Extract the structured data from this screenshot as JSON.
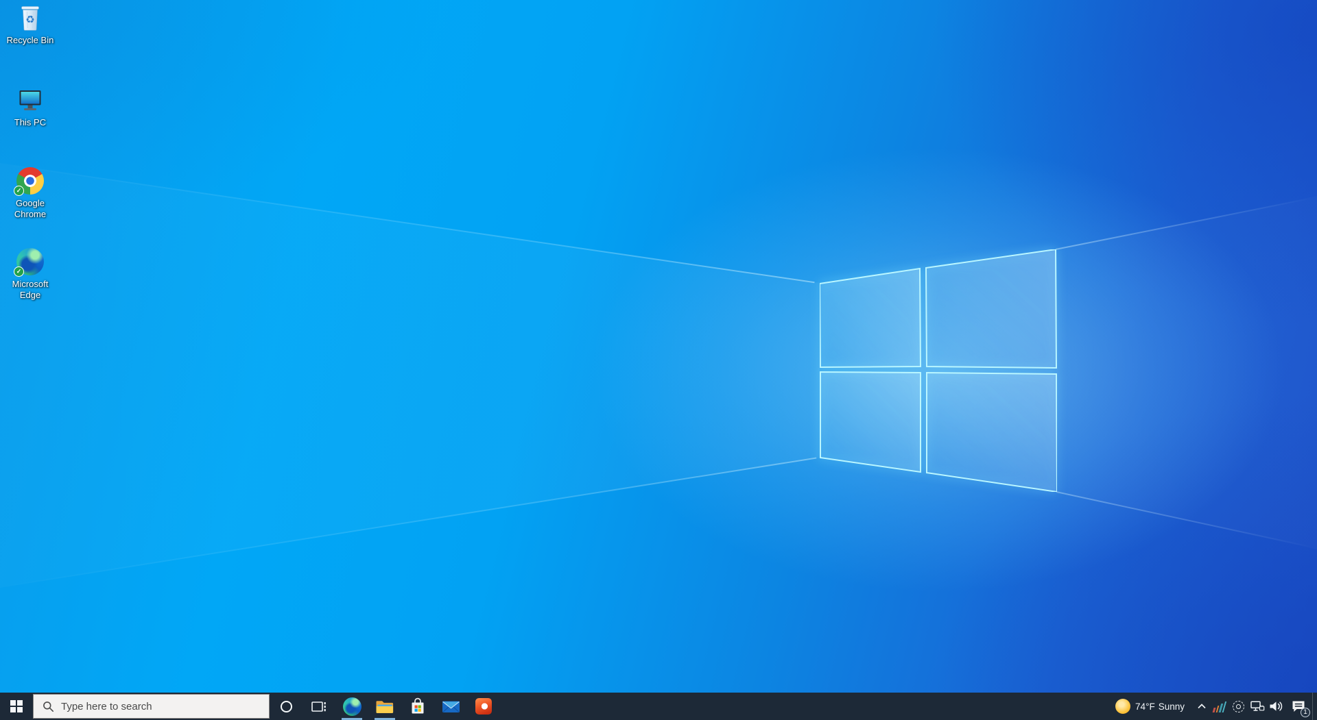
{
  "desktop": {
    "icons": [
      {
        "label": "Recycle Bin",
        "icon": "recycle-bin-icon"
      },
      {
        "label": "This PC",
        "icon": "this-pc-icon"
      },
      {
        "label": "Google Chrome",
        "icon": "chrome-icon",
        "overlay": "check-badge",
        "overlay_glyph": "✓"
      },
      {
        "label": "Microsoft Edge",
        "icon": "edge-icon",
        "overlay": "check-badge",
        "overlay_glyph": "✓"
      }
    ]
  },
  "taskbar": {
    "search": {
      "placeholder": "Type here to search",
      "icon": "search-icon"
    },
    "buttons": [
      {
        "icon": "windows-start-icon"
      },
      {
        "icon": "cortana-icon"
      },
      {
        "icon": "task-view-icon"
      },
      {
        "icon": "edge-icon",
        "open": true
      },
      {
        "icon": "file-explorer-icon",
        "open": true
      },
      {
        "icon": "microsoft-store-icon",
        "open": false
      },
      {
        "icon": "mail-icon",
        "open": false
      },
      {
        "icon": "office-icon",
        "open": false
      }
    ],
    "tray": {
      "weather": {
        "icon": "sun-icon",
        "temperature": "74°F",
        "condition": "Sunny"
      },
      "icons": [
        "chevron-up-icon",
        "colored-bars-icon",
        "capture-icon",
        "ethernet-icon",
        "volume-icon"
      ],
      "action_center": {
        "icon": "action-center-icon",
        "badge_count": "1"
      }
    }
  },
  "colors": {
    "wallpaper_azure": "#00a6f4",
    "wallpaper_royal": "#1b52cb",
    "logo_edge_glow": "#b9f6ff",
    "taskbar_bg": "#1d2937",
    "open_app_indicator": "#7fb2da",
    "search_box_bg": "#f3f2f1",
    "check_badge_green": "#23a24b",
    "sun_yellow": "#f5b81f"
  }
}
